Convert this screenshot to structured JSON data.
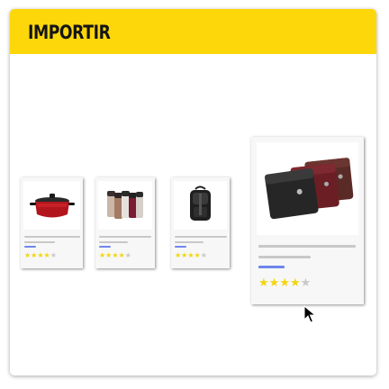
{
  "header": {
    "title": "IMPORTIR",
    "color": "#fdd70a"
  },
  "colors": {
    "price": "#6e86ee",
    "star_on": "#f2d60c",
    "star_off": "#c9c9c9",
    "line": "#c8c8c8"
  },
  "products": [
    {
      "icon": "cooking-pot-icon",
      "rating": 4,
      "max_rating": 5
    },
    {
      "icon": "thermos-flasks-icon",
      "rating": 4,
      "max_rating": 5
    },
    {
      "icon": "backpack-icon",
      "rating": 4,
      "max_rating": 5
    },
    {
      "icon": "wallets-icon",
      "rating": 4,
      "max_rating": 5,
      "highlighted": true
    }
  ]
}
